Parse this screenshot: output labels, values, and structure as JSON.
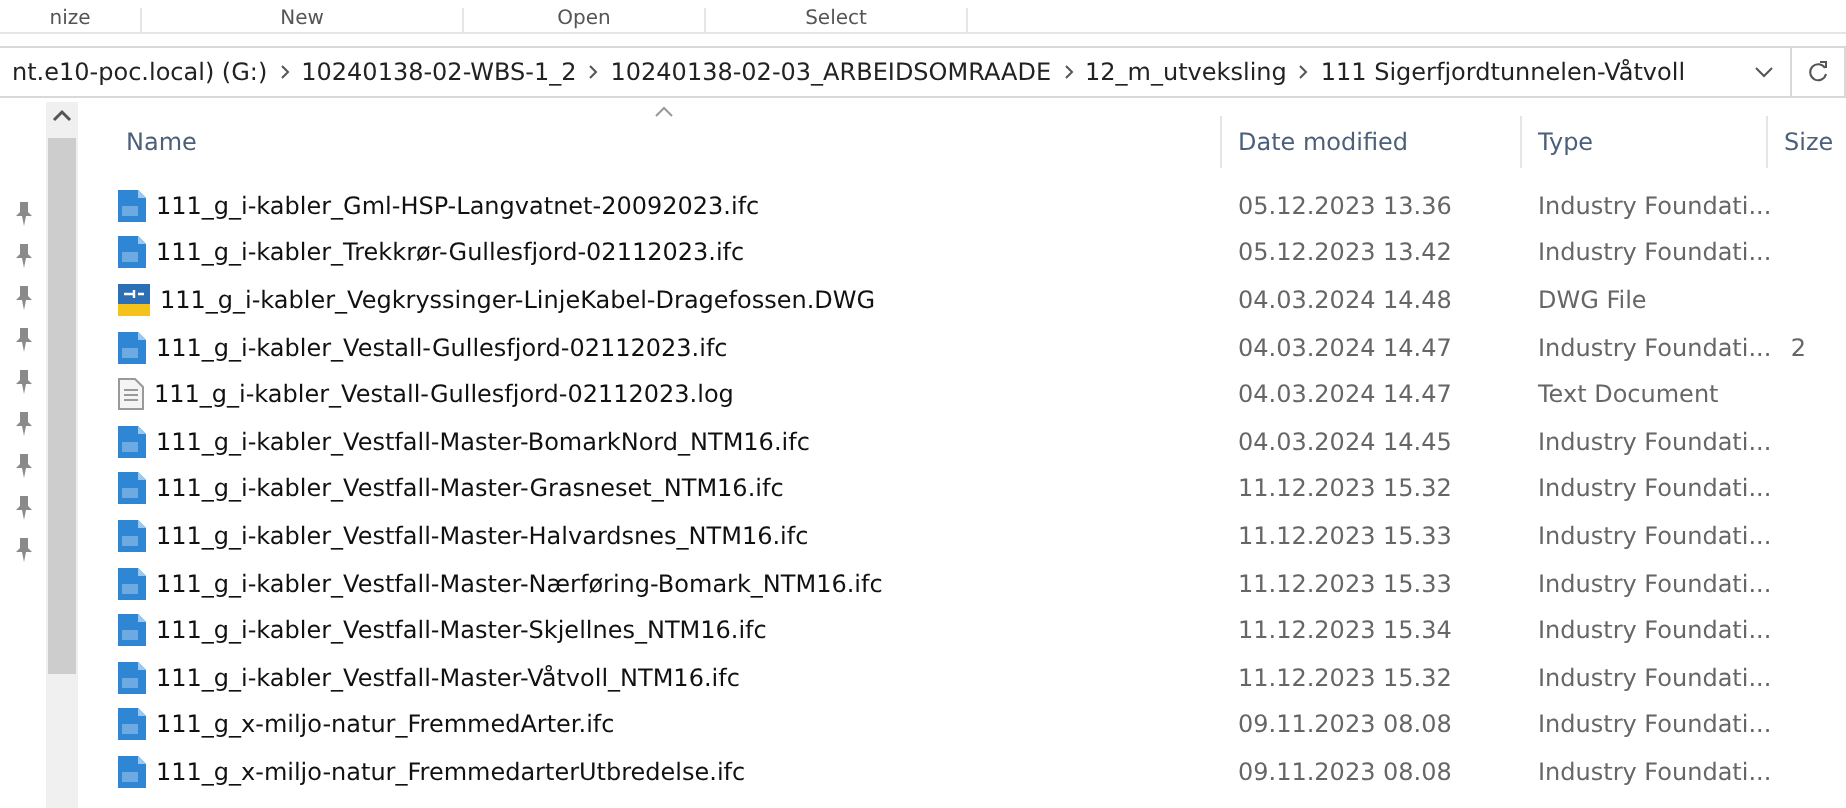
{
  "ribbon": [
    "nize",
    "New",
    "Open",
    "Select"
  ],
  "address": {
    "crumbs": [
      "nt.e10-poc.local) (G:)",
      "10240138-02-WBS-1_2",
      "10240138-02-03_ARBEIDSOMRAADE",
      "12_m_utveksling",
      "111 Sigerfjordtunnelen-Våtvoll"
    ]
  },
  "columns": [
    "Name",
    "Date modified",
    "Type",
    "Size"
  ],
  "files": [
    {
      "kind": "ifc",
      "name": "111_g_i-kabler_Gml-HSP-Langvatnet-20092023.ifc",
      "date": "05.12.2023 13.36",
      "type": "Industry Foundati..."
    },
    {
      "kind": "ifc",
      "name": "111_g_i-kabler_Trekkrør-Gullesfjord-02112023.ifc",
      "date": "05.12.2023 13.42",
      "type": "Industry Foundati..."
    },
    {
      "kind": "dwg",
      "name": "111_g_i-kabler_Vegkryssinger-LinjeKabel-Dragefossen.DWG",
      "date": "04.03.2024 14.48",
      "type": "DWG File"
    },
    {
      "kind": "ifc",
      "name": "111_g_i-kabler_Vestall-Gullesfjord-02112023.ifc",
      "date": "04.03.2024 14.47",
      "type": "Industry Foundati...",
      "size": "2"
    },
    {
      "kind": "text",
      "name": "111_g_i-kabler_Vestall-Gullesfjord-02112023.log",
      "date": "04.03.2024 14.47",
      "type": "Text Document"
    },
    {
      "kind": "ifc",
      "name": "111_g_i-kabler_Vestfall-Master-BomarkNord_NTM16.ifc",
      "date": "04.03.2024 14.45",
      "type": "Industry Foundati..."
    },
    {
      "kind": "ifc",
      "name": "111_g_i-kabler_Vestfall-Master-Grasneset_NTM16.ifc",
      "date": "11.12.2023 15.32",
      "type": "Industry Foundati..."
    },
    {
      "kind": "ifc",
      "name": "111_g_i-kabler_Vestfall-Master-Halvardsnes_NTM16.ifc",
      "date": "11.12.2023 15.33",
      "type": "Industry Foundati..."
    },
    {
      "kind": "ifc",
      "name": "111_g_i-kabler_Vestfall-Master-Nærføring-Bomark_NTM16.ifc",
      "date": "11.12.2023 15.33",
      "type": "Industry Foundati..."
    },
    {
      "kind": "ifc",
      "name": "111_g_i-kabler_Vestfall-Master-Skjellnes_NTM16.ifc",
      "date": "11.12.2023 15.34",
      "type": "Industry Foundati..."
    },
    {
      "kind": "ifc",
      "name": "111_g_i-kabler_Vestfall-Master-Våtvoll_NTM16.ifc",
      "date": "11.12.2023 15.32",
      "type": "Industry Foundati..."
    },
    {
      "kind": "ifc",
      "name": "111_g_x-miljo-natur_FremmedArter.ifc",
      "date": "09.11.2023 08.08",
      "type": "Industry Foundati..."
    },
    {
      "kind": "ifc",
      "name": "111_g_x-miljo-natur_FremmedarterUtbredelse.ifc",
      "date": "09.11.2023 08.08",
      "type": "Industry Foundati..."
    }
  ]
}
